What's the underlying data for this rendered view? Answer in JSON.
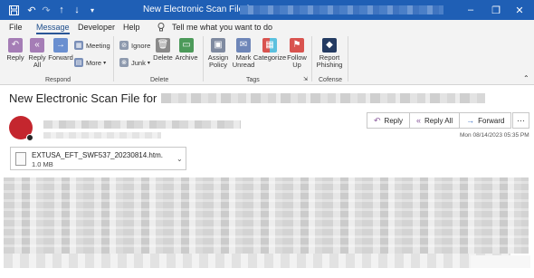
{
  "window": {
    "title": "New Electronic Scan File for",
    "controls": {
      "minimize": "–",
      "restore": "❐",
      "close": "✕"
    }
  },
  "quick_access": {
    "save_icon": "save-icon",
    "undo_icon": "undo-icon",
    "redo_icon": "redo-icon",
    "up_icon": "up-arrow-icon",
    "down_icon": "down-arrow-icon"
  },
  "menu": {
    "items": [
      "File",
      "Message",
      "Developer",
      "Help"
    ],
    "active": "Message",
    "tell_me": "Tell me what you want to do"
  },
  "ribbon": {
    "respond": {
      "label": "Respond",
      "reply": "Reply",
      "reply_all": "Reply All",
      "forward": "Forward",
      "meeting": "Meeting",
      "more": "More"
    },
    "delete": {
      "label": "Delete",
      "ignore": "Ignore",
      "junk": "Junk",
      "delete": "Delete",
      "archive": "Archive"
    },
    "tags": {
      "label": "Tags",
      "assign_policy": "Assign Policy",
      "mark_unread": "Mark Unread",
      "categorize": "Categorize",
      "follow_up": "Follow Up"
    },
    "cofense": {
      "label": "Cofense",
      "report_phishing": "Report Phishing"
    }
  },
  "message": {
    "subject": "New Electronic Scan File for",
    "actions": {
      "reply": "Reply",
      "reply_all": "Reply All",
      "forward": "Forward",
      "more": "···"
    },
    "date": "Mon 08/14/2023 05:35 PM",
    "attachment": {
      "name": "EXTUSA_EFT_SWF537_20230814.htm.",
      "size": "1.0 MB"
    }
  },
  "colors": {
    "titlebar": "#1f5fb5",
    "avatar": "#c4262e",
    "reply_accent": "#8a5a9b"
  }
}
